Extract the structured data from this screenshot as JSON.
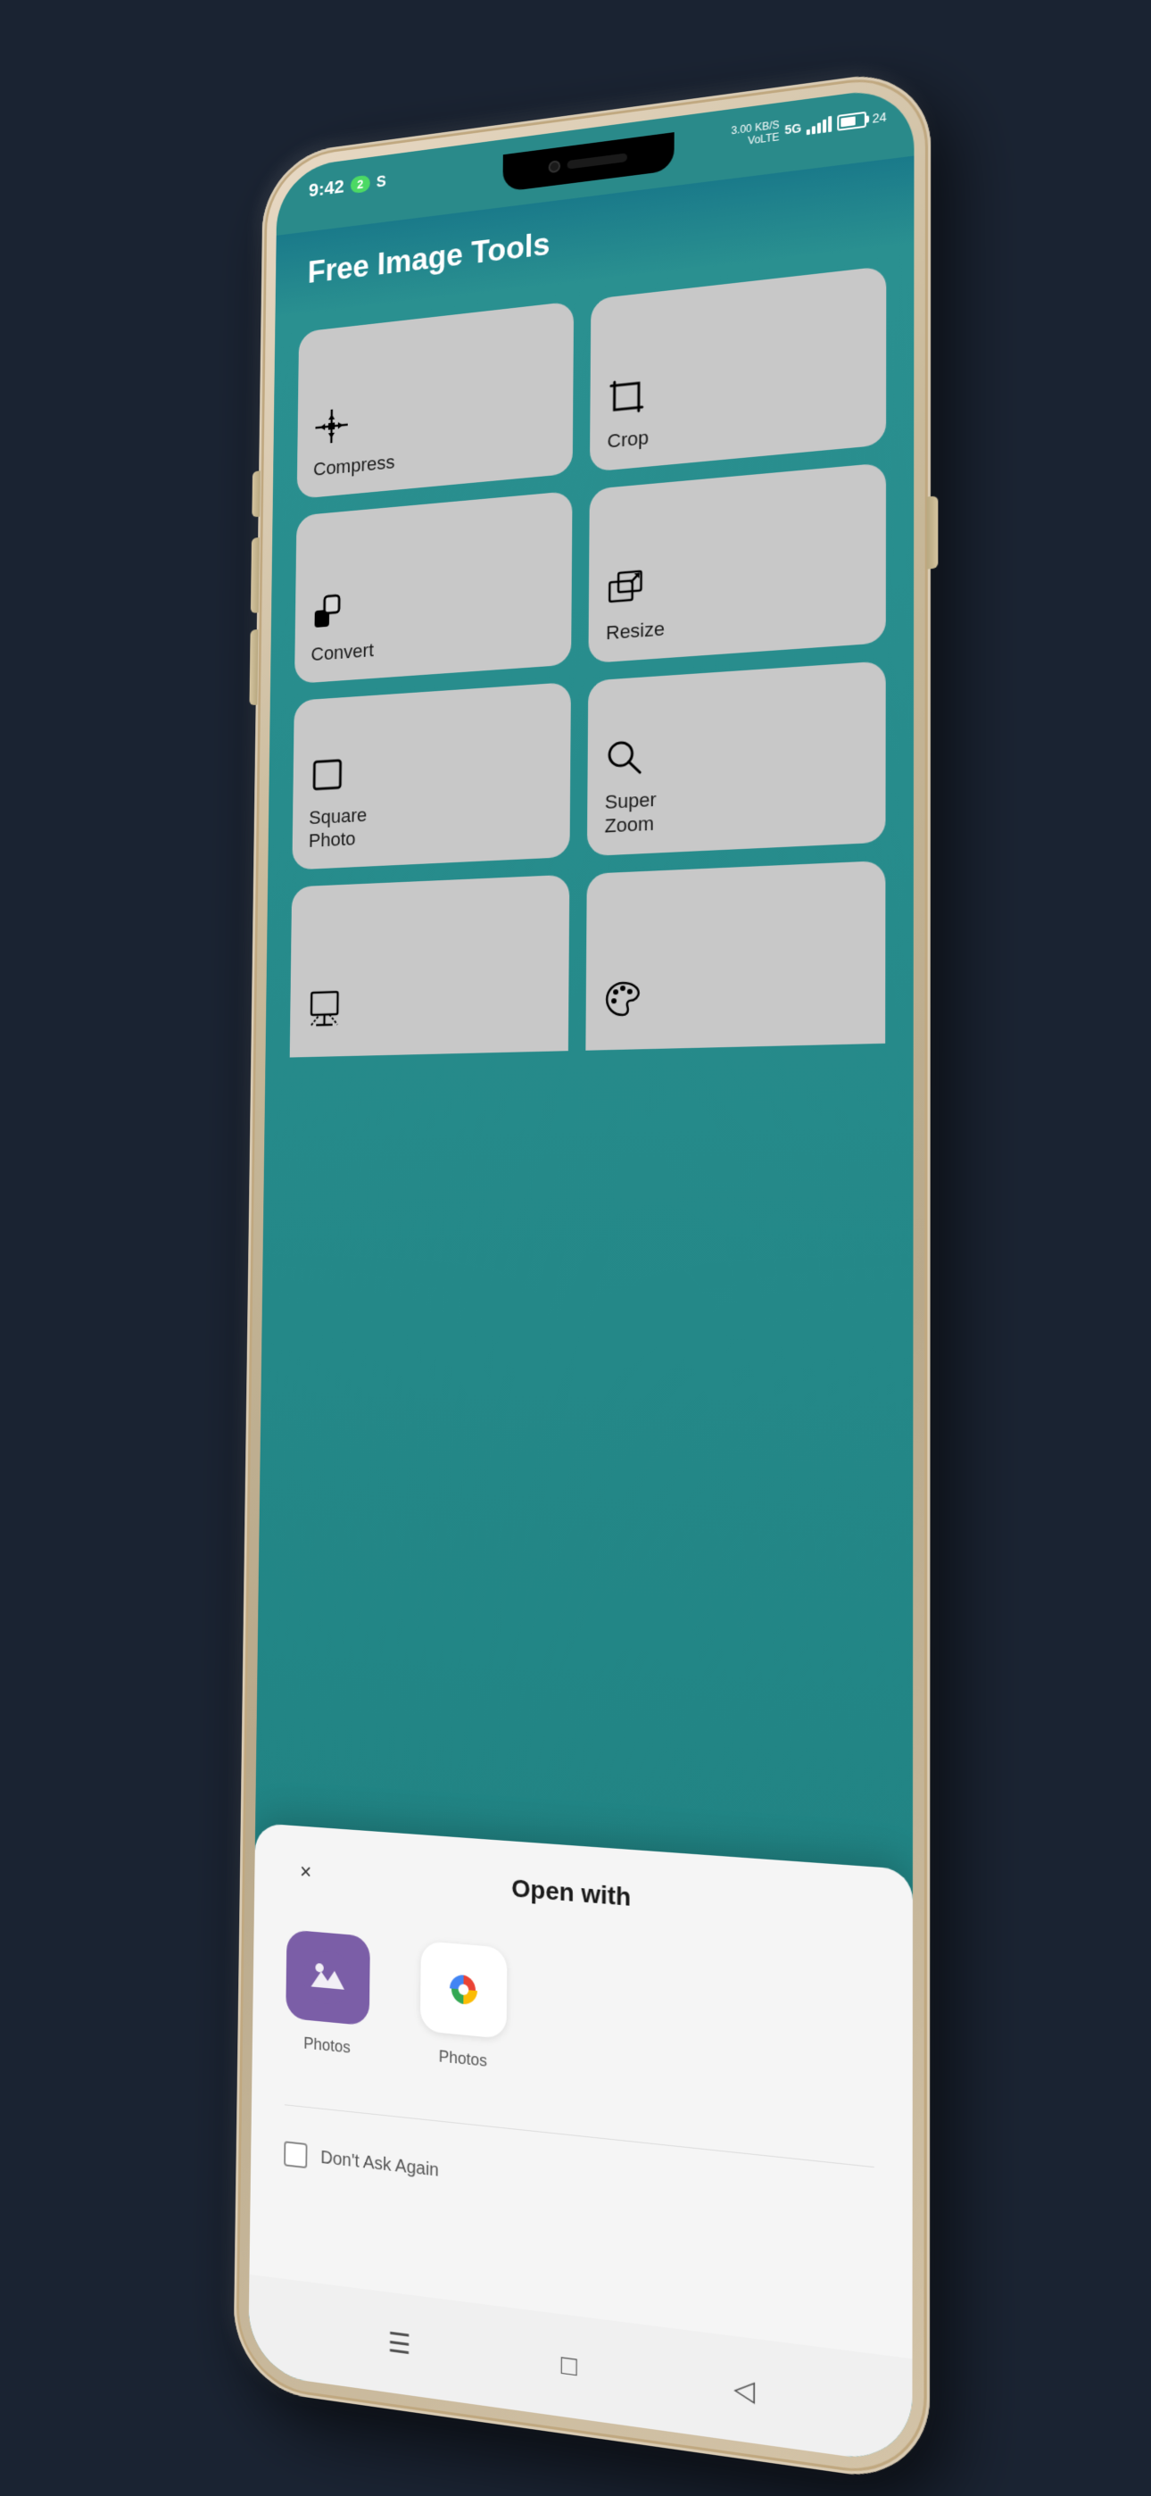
{
  "statusBar": {
    "time": "9:42",
    "wifiCount": "2",
    "simLabel": "S",
    "networkInfo": "3.00 KB/S\nVoLTE",
    "networkType": "5G",
    "batteryLevel": "24"
  },
  "header": {
    "title": "Free Image Tools"
  },
  "tools": [
    {
      "id": "compress",
      "label": "Compress",
      "icon": "⊞"
    },
    {
      "id": "crop",
      "label": "Crop",
      "icon": "⊡"
    },
    {
      "id": "convert",
      "label": "Convert",
      "icon": "◑"
    },
    {
      "id": "resize",
      "label": "Resize",
      "icon": "⤢"
    },
    {
      "id": "square-photo",
      "label": "Square Photo",
      "icon": "□"
    },
    {
      "id": "super-zoom",
      "label": "Super Zoom",
      "icon": "🔍"
    },
    {
      "id": "easel",
      "label": "",
      "icon": "🖼"
    },
    {
      "id": "palette",
      "label": "",
      "icon": "🎨"
    }
  ],
  "bottomSheet": {
    "title": "Open with",
    "closeLabel": "×",
    "apps": [
      {
        "id": "photos-ios",
        "name": "Photos",
        "type": "ios"
      },
      {
        "id": "photos-google",
        "name": "Photos",
        "type": "google"
      }
    ],
    "checkbox": {
      "label": "Don't Ask Again",
      "checked": false
    }
  },
  "navBar": {
    "icons": [
      "☰",
      "□",
      "◁"
    ]
  }
}
